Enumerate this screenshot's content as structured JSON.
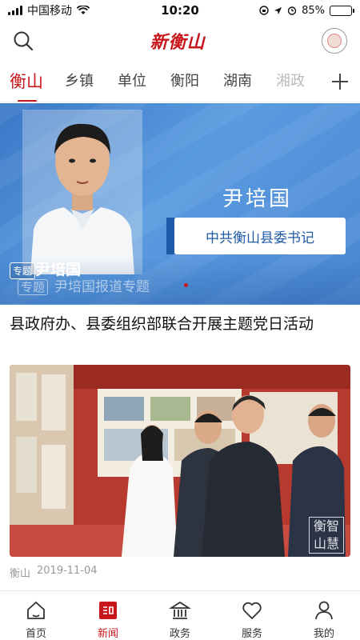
{
  "status_bar": {
    "carrier": "中国移动",
    "time": "10:20",
    "battery": "85%",
    "battery_level": 0.85,
    "icons": [
      "signal-icon",
      "wifi-icon",
      "rotation-lock-icon",
      "location-icon",
      "alarm-icon",
      "battery-icon"
    ]
  },
  "header": {
    "logo": "新衡山",
    "icons": [
      "search-icon",
      "avatar"
    ]
  },
  "tabs": {
    "items": [
      "衡山",
      "乡镇",
      "单位",
      "衡阳",
      "湖南",
      "湘政"
    ],
    "active_index": 0,
    "add_icon": "plus-icon"
  },
  "banner": {
    "tag": "专题",
    "title": "尹培国",
    "person_name": "尹培国",
    "person_title": "中共衡山县委书记",
    "ghost_tag": "专题",
    "ghost_text": "尹培国报道专题"
  },
  "article": {
    "title": "县政府办、县委组织部联合开展主题党日活动",
    "source": "衡山",
    "date": "2019-11-04",
    "watermark": "衡智山慧"
  },
  "bottom_nav": {
    "items": [
      {
        "label": "首页",
        "icon": "home-icon"
      },
      {
        "label": "新闻",
        "icon": "news-icon"
      },
      {
        "label": "政务",
        "icon": "government-icon"
      },
      {
        "label": "服务",
        "icon": "heart-icon"
      },
      {
        "label": "我的",
        "icon": "user-icon"
      }
    ],
    "active_index": 1
  },
  "colors": {
    "accent": "#c8161d",
    "banner_blue": "#4a86d2"
  }
}
